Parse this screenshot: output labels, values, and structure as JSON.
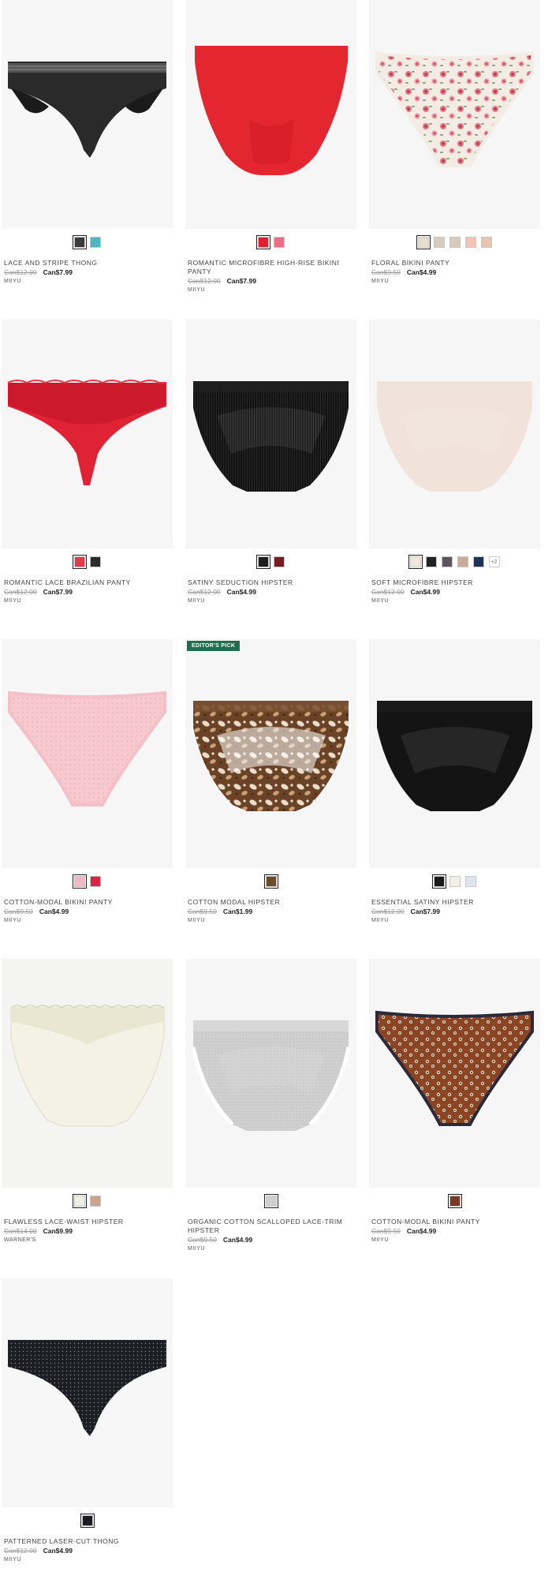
{
  "products": [
    {
      "name": "LACE AND STRIPE THONG",
      "original_price": "Can$12.00",
      "sale_price": "Can$7.99",
      "brand": "MIIYU",
      "badge": "",
      "swatches": [
        {
          "color": "#3b3b3b",
          "selected": true
        },
        {
          "color": "#4fb7c0"
        }
      ]
    },
    {
      "name": "ROMANTIC MICROFIBRE HIGH-RISE BIKINI PANTY",
      "original_price": "Can$12.00",
      "sale_price": "Can$7.99",
      "brand": "MIIYU",
      "badge": "",
      "swatches": [
        {
          "color": "#e21d2e",
          "selected": true
        },
        {
          "color": "#ec6f84"
        }
      ]
    },
    {
      "name": "FLORAL BIKINI PANTY",
      "original_price": "Can$9.50",
      "sale_price": "Can$4.99",
      "brand": "MIIYU",
      "badge": "",
      "swatches": [
        {
          "color": "#e7dccd",
          "selected": true
        },
        {
          "color": "#d6ccbf"
        },
        {
          "color": "#d8c9b8"
        },
        {
          "color": "#f3c6b3"
        },
        {
          "color": "#e9c2b0"
        }
      ]
    },
    {
      "name": "ROMANTIC LACE BRAZILIAN PANTY",
      "original_price": "Can$12.00",
      "sale_price": "Can$7.99",
      "brand": "MIIYU",
      "badge": "",
      "swatches": [
        {
          "color": "#e03a4e",
          "selected": true
        },
        {
          "color": "#2b2b2b"
        }
      ]
    },
    {
      "name": "SATINY SEDUCTION HIPSTER",
      "original_price": "Can$12.00",
      "sale_price": "Can$4.99",
      "brand": "MIIYU",
      "badge": "",
      "swatches": [
        {
          "color": "#1e1e1e",
          "selected": true
        },
        {
          "color": "#7a1c22"
        }
      ]
    },
    {
      "name": "SOFT MICROFIBRE HIPSTER",
      "original_price": "Can$12.00",
      "sale_price": "Can$4.99",
      "brand": "MIIYU",
      "badge": "",
      "swatches": [
        {
          "color": "#f1e6dc",
          "selected": true
        },
        {
          "color": "#222222"
        },
        {
          "color": "#5b5560"
        },
        {
          "color": "#c9ab97"
        },
        {
          "color": "#1f3355"
        }
      ],
      "more_swatches": "+2"
    },
    {
      "name": "COTTON-MODAL BIKINI PANTY",
      "original_price": "Can$9.50",
      "sale_price": "Can$4.99",
      "brand": "MIIYU",
      "badge": "",
      "swatches": [
        {
          "color": "#f4b6c4",
          "selected": true
        },
        {
          "color": "#d92447"
        }
      ]
    },
    {
      "name": "COTTON MODAL HIPSTER",
      "original_price": "Can$9.50",
      "sale_price": "Can$1.99",
      "brand": "MIIYU",
      "badge": "EDITOR'S PICK",
      "swatches": [
        {
          "color": "#6b4a2e",
          "selected": true
        }
      ]
    },
    {
      "name": "ESSENTIAL SATINY HIPSTER",
      "original_price": "Can$12.00",
      "sale_price": "Can$7.99",
      "brand": "MIIYU",
      "badge": "",
      "swatches": [
        {
          "color": "#1a1a1a",
          "selected": true
        },
        {
          "color": "#f2efe9"
        },
        {
          "color": "#dfe3ec"
        }
      ]
    },
    {
      "name": "FLAWLESS LACE-WAIST HIPSTER",
      "original_price": "Can$14.00",
      "sale_price": "Can$9.99",
      "brand": "WARNER'S",
      "badge": "",
      "swatches": [
        {
          "color": "#eff0e4",
          "selected": true
        },
        {
          "color": "#c9a48c"
        }
      ]
    },
    {
      "name": "ORGANIC COTTON SCALLOPED LACE-TRIM HIPSTER",
      "original_price": "Can$9.50",
      "sale_price": "Can$4.99",
      "brand": "MIIYU",
      "badge": "",
      "swatches": [
        {
          "color": "#cfcfcf",
          "selected": true
        }
      ]
    },
    {
      "name": "COTTON-MODAL BIKINI PANTY",
      "original_price": "Can$9.50",
      "sale_price": "Can$4.99",
      "brand": "MIIYU",
      "badge": "",
      "swatches": [
        {
          "color": "#7a3a24",
          "selected": true
        }
      ]
    },
    {
      "name": "PATTERNED LASER-CUT THONG",
      "original_price": "Can$12.00",
      "sale_price": "Can$4.99",
      "brand": "MIIYU",
      "badge": "",
      "swatches": [
        {
          "color": "#1c1c22",
          "selected": true
        }
      ]
    }
  ]
}
